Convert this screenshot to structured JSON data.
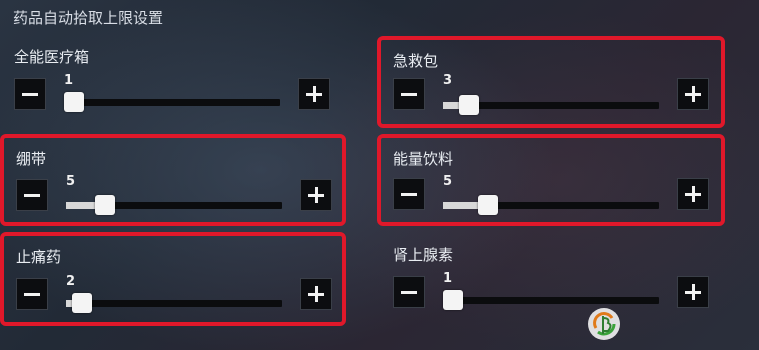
{
  "header": {
    "title": "药品自动拾取上限设置"
  },
  "items": [
    {
      "label": "全能医疗箱",
      "value": "1",
      "level": 0,
      "highlighted": false
    },
    {
      "label": "急救包",
      "value": "3",
      "level": 0.08,
      "highlighted": true
    },
    {
      "label": "绷带",
      "value": "5",
      "level": 0.15,
      "highlighted": true
    },
    {
      "label": "能量饮料",
      "value": "5",
      "level": 0.18,
      "highlighted": true
    },
    {
      "label": "止痛药",
      "value": "2",
      "level": 0.03,
      "highlighted": true
    },
    {
      "label": "肾上腺素",
      "value": "1",
      "level": 0,
      "highlighted": false
    }
  ],
  "colors": {
    "highlight_border": "#e0182a",
    "button_bg": "#0c0d10",
    "slider_fill": "#d8d8d8"
  },
  "icons": {
    "decrease": "minus-icon",
    "increase": "plus-icon"
  }
}
